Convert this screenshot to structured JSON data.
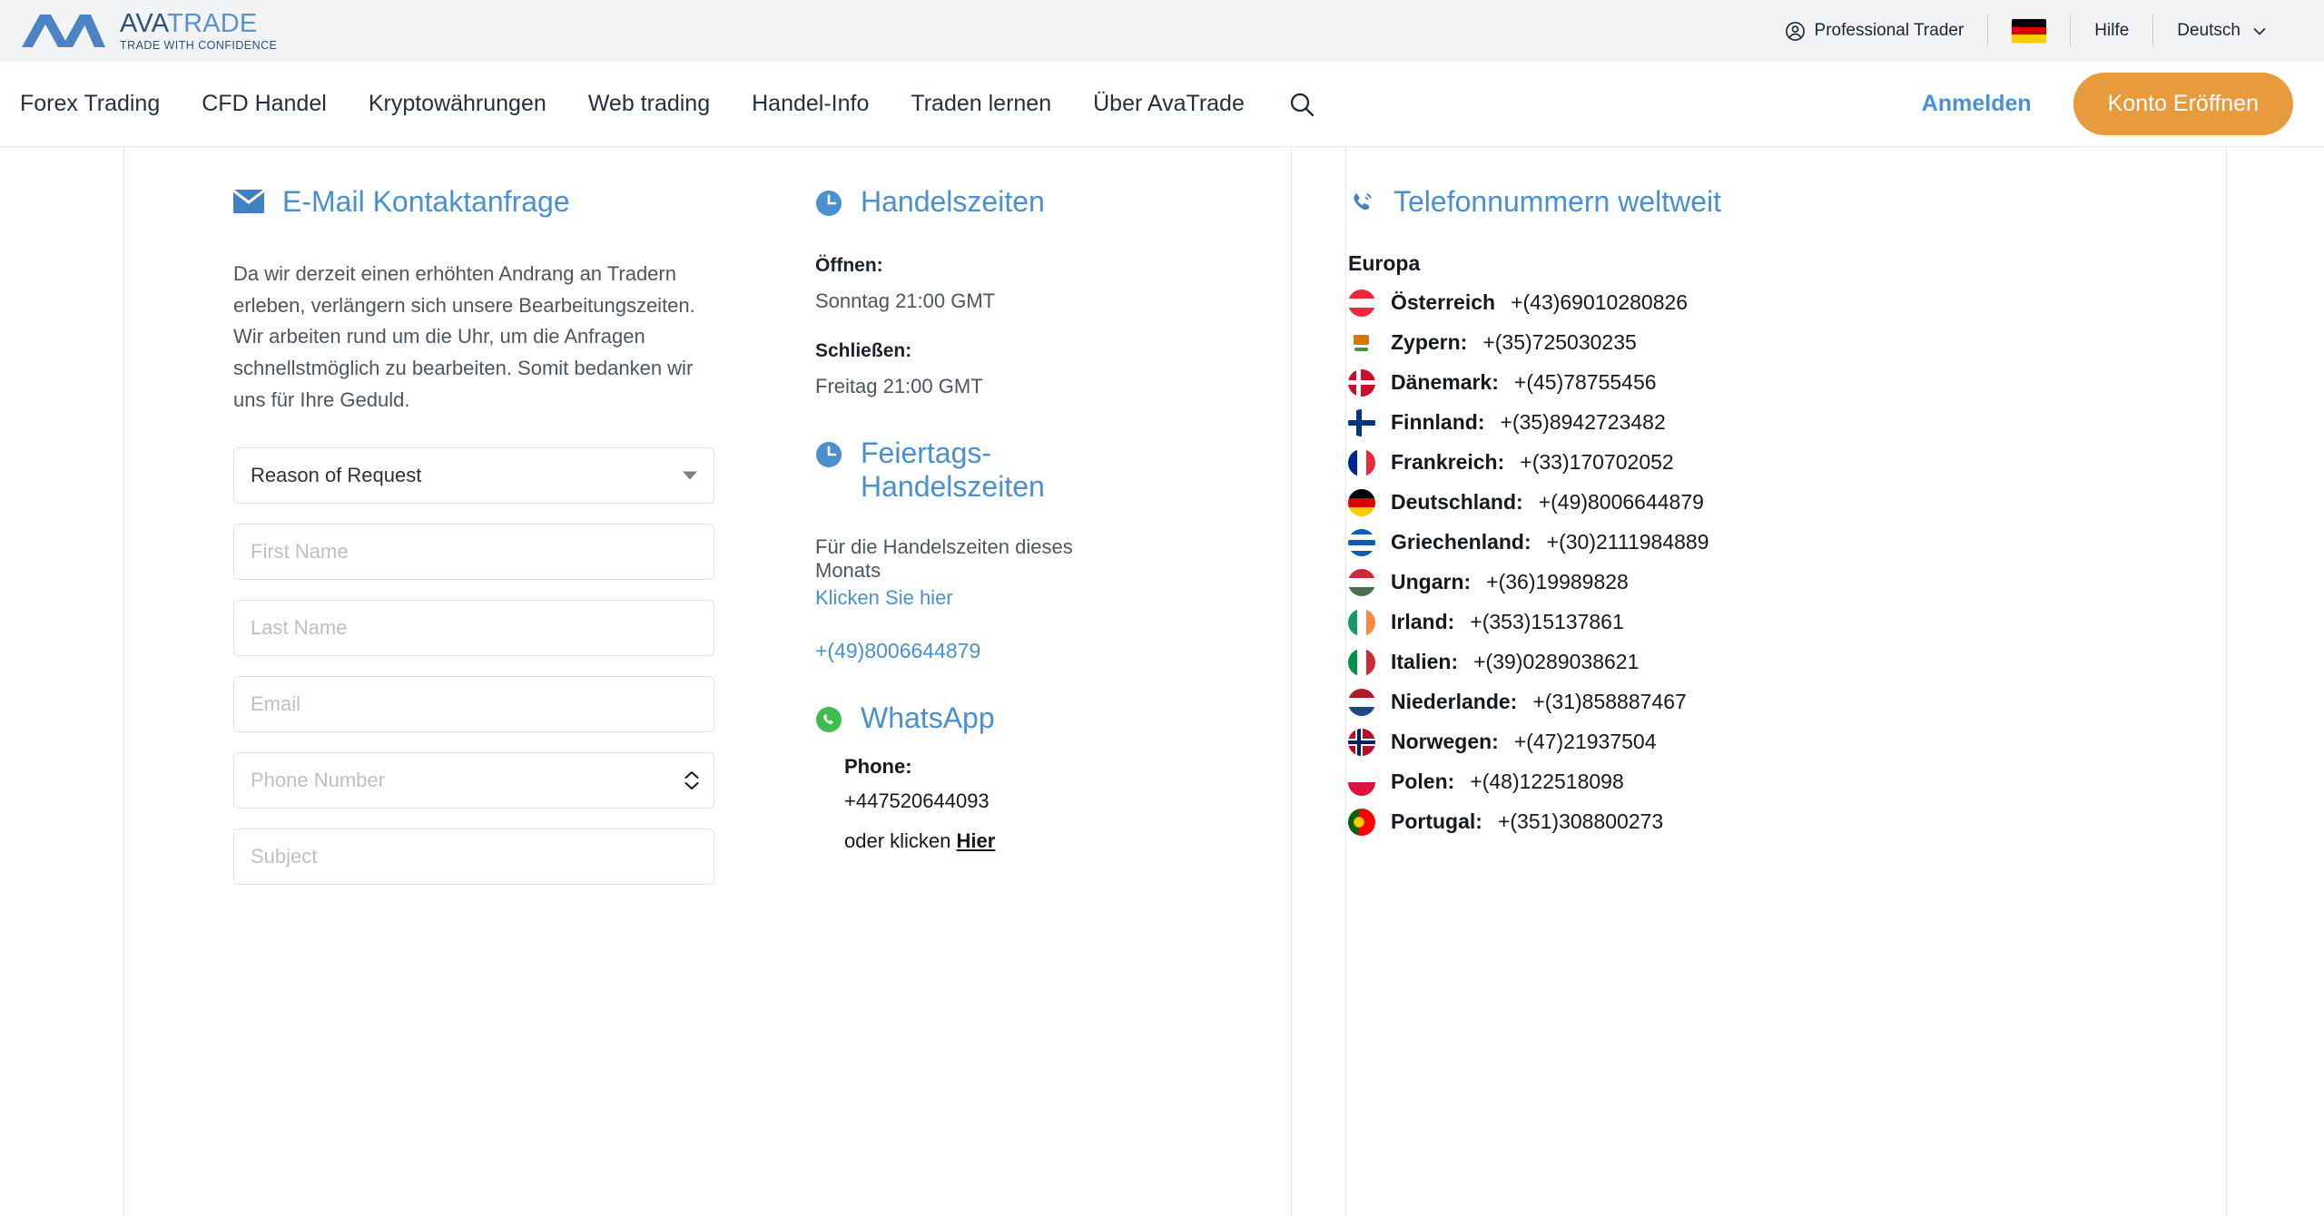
{
  "brand": {
    "name_primary": "AVA",
    "name_secondary": "TRADE",
    "tagline": "TRADE WITH CONFIDENCE",
    "accent_orange": "#e89b3c",
    "accent_blue": "#4a8fd0",
    "logo_blue": "#4a84c4"
  },
  "topbar": {
    "account_type": "Professional Trader",
    "country_flag": "flag-germany-icon",
    "help_label": "Hilfe",
    "language_label": "Deutsch"
  },
  "nav": {
    "links": [
      "Forex Trading",
      "CFD Handel",
      "Kryptowährungen",
      "Web trading",
      "Handel-Info",
      "Traden lernen",
      "Über AvaTrade"
    ],
    "search_icon": "search-icon",
    "signin_label": "Anmelden",
    "cta_label": "Konto Eröffnen"
  },
  "email_section": {
    "icon": "envelope-icon",
    "title": "E-Mail Kontaktanfrage",
    "paragraph": "Da wir derzeit einen erhöhten Andrang an Tradern erleben, verlängern sich unsere Bearbeitungszeiten. Wir arbeiten rund um die Uhr, um die Anfragen schnellstmöglich zu bearbeiten. Somit bedanken wir uns für Ihre Geduld.",
    "form": {
      "reason_selected": "Reason of Request",
      "first_name_placeholder": "First Name",
      "first_name_value": "",
      "last_name_placeholder": "Last Name",
      "last_name_value": "",
      "email_placeholder": "Email",
      "email_value": "",
      "phone_placeholder": "Phone Number",
      "phone_value": "",
      "subject_placeholder": "Subject",
      "subject_value": ""
    }
  },
  "hours_section": {
    "icon": "clock-icon",
    "title": "Handelszeiten",
    "open_label": "Öffnen:",
    "open_value": "Sonntag 21:00 GMT",
    "close_label": "Schließen:",
    "close_value": "Freitag 21:00 GMT"
  },
  "holiday_section": {
    "icon": "clock-icon",
    "title": "Feiertags-Handelszeiten",
    "text_line1": "Für die Handelszeiten dieses",
    "text_line2": "Monats",
    "link_label": "Klicken Sie hier",
    "phone": "+(49)8006644879"
  },
  "whatsapp_section": {
    "icon": "whatsapp-icon",
    "title": "WhatsApp",
    "phone_label": "Phone:",
    "phone_value": "+447520644093",
    "or_prefix": "oder klicken ",
    "or_link": "Hier"
  },
  "phones_section": {
    "icon": "phone-icon",
    "title": "Telefonnummern weltweit",
    "region": "Europa",
    "entries": [
      {
        "country": "Österreich",
        "number": "+(43)69010280826",
        "flag": "flag-austria-icon"
      },
      {
        "country": "Zypern:",
        "number": "+(35)725030235",
        "flag": "flag-cyprus-icon"
      },
      {
        "country": "Dänemark:",
        "number": "+(45)78755456",
        "flag": "flag-denmark-icon"
      },
      {
        "country": "Finnland:",
        "number": "+(35)8942723482",
        "flag": "flag-finland-icon"
      },
      {
        "country": "Frankreich:",
        "number": "+(33)170702052",
        "flag": "flag-france-icon"
      },
      {
        "country": "Deutschland:",
        "number": "+(49)8006644879",
        "flag": "flag-germany-icon"
      },
      {
        "country": "Griechenland:",
        "number": "+(30)2111984889",
        "flag": "flag-greece-icon"
      },
      {
        "country": "Ungarn:",
        "number": "+(36)19989828",
        "flag": "flag-hungary-icon"
      },
      {
        "country": "Irland:",
        "number": "+(353)15137861",
        "flag": "flag-ireland-icon"
      },
      {
        "country": "Italien:",
        "number": "+(39)0289038621",
        "flag": "flag-italy-icon"
      },
      {
        "country": "Niederlande:",
        "number": "+(31)858887467",
        "flag": "flag-netherlands-icon"
      },
      {
        "country": "Norwegen:",
        "number": "+(47)21937504",
        "flag": "flag-norway-icon"
      },
      {
        "country": "Polen:",
        "number": "+(48)122518098",
        "flag": "flag-poland-icon"
      },
      {
        "country": "Portugal:",
        "number": "+(351)308800273",
        "flag": "flag-portugal-icon"
      }
    ]
  }
}
